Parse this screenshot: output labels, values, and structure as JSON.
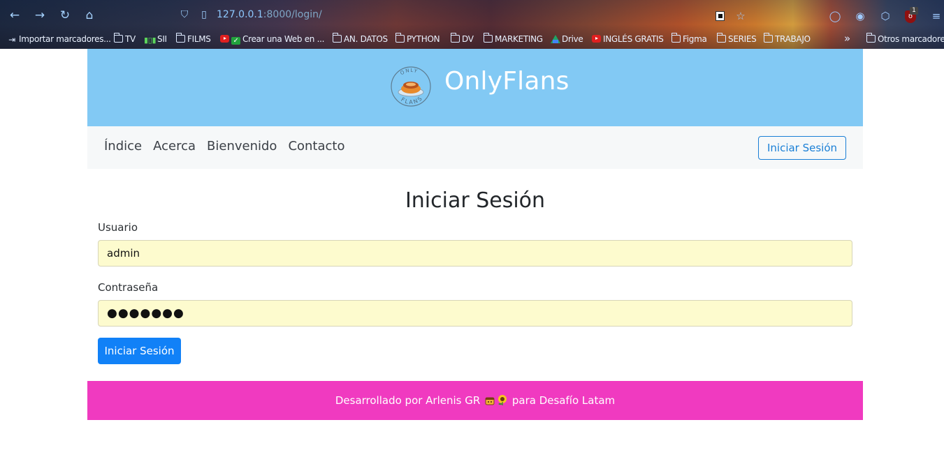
{
  "browser": {
    "url_host": "127.0.0.1",
    "url_rest": ":8000/login/",
    "ublock_count": "1",
    "bookmarks": [
      {
        "label": "Importar marcadores...",
        "icon": "import-icon"
      },
      {
        "label": "TV",
        "icon": "folder-icon"
      },
      {
        "label": "SII",
        "icon": "bars-icon"
      },
      {
        "label": "FILMS",
        "icon": "folder-icon"
      },
      {
        "label": "Crear una Web en ...",
        "icon": "youtube-check-icon"
      },
      {
        "label": "AN. DATOS",
        "icon": "folder-icon"
      },
      {
        "label": "PYTHON",
        "icon": "folder-icon"
      },
      {
        "label": "DV",
        "icon": "folder-icon"
      },
      {
        "label": "MARKETING",
        "icon": "folder-icon"
      },
      {
        "label": "Drive",
        "icon": "drive-icon"
      },
      {
        "label": "INGLÉS GRATIS",
        "icon": "youtube-icon"
      },
      {
        "label": "Figma",
        "icon": "folder-icon"
      },
      {
        "label": "SERIES",
        "icon": "folder-icon"
      },
      {
        "label": "TRABAJO",
        "icon": "folder-icon"
      }
    ],
    "other_bookmarks": "Otros marcadores"
  },
  "header": {
    "brand": "OnlyFlans",
    "logo_top_text": "ONLY",
    "logo_bottom_text": "FLANS"
  },
  "nav": {
    "links": [
      "Índice",
      "Acerca",
      "Bienvenido",
      "Contacto"
    ],
    "login_button": "Iniciar Sesión"
  },
  "form": {
    "title": "Iniciar Sesión",
    "username_label": "Usuario",
    "username_value": "admin",
    "password_label": "Contraseña",
    "password_value": "●●●●●●●",
    "submit_label": "Iniciar Sesión"
  },
  "footer": {
    "text_before": "Desarrollado por Arlenis GR",
    "text_after": "para Desafío Latam"
  },
  "colors": {
    "hero": "#82c9f4",
    "footer": "#f03ac0",
    "primary": "#1181f7",
    "input_bg": "#fdfbce"
  }
}
